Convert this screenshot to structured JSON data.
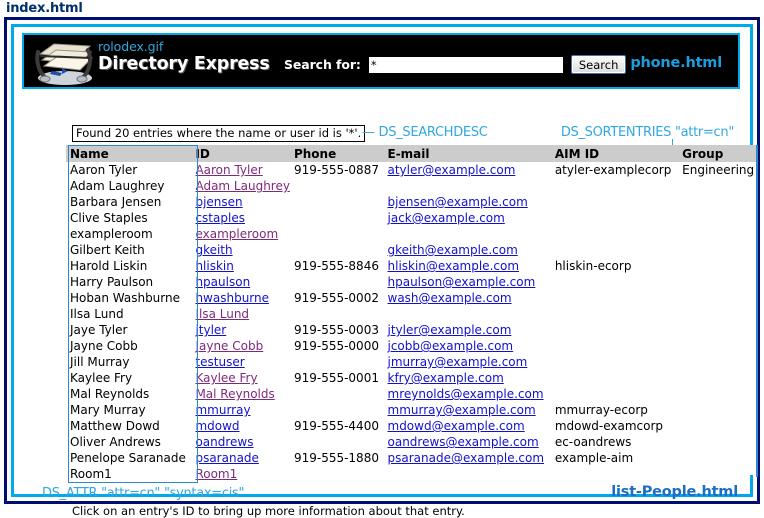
{
  "page": {
    "title": "index.html"
  },
  "header": {
    "logo_icon": "rolodex-icon",
    "image_filename": "rolodex.gif",
    "app_title": "Directory Express",
    "search_label": "Search for:",
    "search_value": "*",
    "search_placeholder": "",
    "search_button": "Search",
    "corner_link": "phone.html",
    "accent_cyan": "#00a8ec",
    "frame_navy": "#000e6e"
  },
  "annotations": {
    "search_description": "Found 20 entries where the name or user id is '*'.",
    "searchdesc_tag": "— DS_SEARCHDESC",
    "sortentries_tag": "DS_SORTENTRIES",
    "sortentries_arg": "\"attr=cn\"",
    "attr_tag": "DS_ATTR \"attr=cn\" \"syntax=cis\"",
    "footer_link": "list-People.html"
  },
  "table": {
    "columns": [
      "Name",
      "ID",
      "Phone",
      "E-mail",
      "AIM ID",
      "Group"
    ],
    "rows": [
      {
        "name": "Aaron Tyler",
        "id": "Aaron Tyler",
        "id_state": "visited",
        "phone": "919-555-0887",
        "email": "atyler@example.com",
        "email_state": "blue",
        "aim": "atyler-examplecorp",
        "group": "Engineering"
      },
      {
        "name": "Adam Laughrey",
        "id": "Adam Laughrey",
        "id_state": "visited",
        "phone": "",
        "email": "",
        "email_state": "blue",
        "aim": "",
        "group": ""
      },
      {
        "name": "Barbara Jensen",
        "id": "bjensen",
        "id_state": "blue",
        "phone": "",
        "email": "bjensen@example.com",
        "email_state": "blue",
        "aim": "",
        "group": ""
      },
      {
        "name": "Clive Staples",
        "id": "cstaples",
        "id_state": "blue",
        "phone": "",
        "email": "jack@example.com",
        "email_state": "blue",
        "aim": "",
        "group": ""
      },
      {
        "name": "exampleroom",
        "id": "exampleroom",
        "id_state": "visited",
        "phone": "",
        "email": "",
        "email_state": "blue",
        "aim": "",
        "group": ""
      },
      {
        "name": "Gilbert Keith",
        "id": "gkeith",
        "id_state": "blue",
        "phone": "",
        "email": "gkeith@example.com",
        "email_state": "blue",
        "aim": "",
        "group": ""
      },
      {
        "name": "Harold Liskin",
        "id": "hliskin",
        "id_state": "blue",
        "phone": "919-555-8846",
        "email": "hliskin@example.com",
        "email_state": "blue",
        "aim": "hliskin-ecorp",
        "group": ""
      },
      {
        "name": "Harry Paulson",
        "id": "hpaulson",
        "id_state": "blue",
        "phone": "",
        "email": "hpaulson@example.com",
        "email_state": "blue",
        "aim": "",
        "group": ""
      },
      {
        "name": "Hoban Washburne",
        "id": "hwashburne",
        "id_state": "blue",
        "phone": "919-555-0002",
        "email": "wash@example.com",
        "email_state": "blue",
        "aim": "",
        "group": ""
      },
      {
        "name": "Ilsa Lund",
        "id": "Ilsa Lund",
        "id_state": "visited",
        "phone": "",
        "email": "",
        "email_state": "blue",
        "aim": "",
        "group": ""
      },
      {
        "name": "Jaye Tyler",
        "id": "jtyler",
        "id_state": "blue",
        "phone": "919-555-0003",
        "email": "jtyler@example.com",
        "email_state": "blue",
        "aim": "",
        "group": ""
      },
      {
        "name": "Jayne Cobb",
        "id": "Jayne Cobb",
        "id_state": "visited",
        "phone": "919-555-0000",
        "email": "jcobb@example.com",
        "email_state": "blue",
        "aim": "",
        "group": ""
      },
      {
        "name": "Jill Murray",
        "id": "testuser",
        "id_state": "blue",
        "phone": "",
        "email": "jmurray@example.com",
        "email_state": "blue",
        "aim": "",
        "group": ""
      },
      {
        "name": "Kaylee Fry",
        "id": "Kaylee Fry",
        "id_state": "visited",
        "phone": "919-555-0001",
        "email": "kfry@example.com",
        "email_state": "blue",
        "aim": "",
        "group": ""
      },
      {
        "name": "Mal Reynolds",
        "id": "Mal Reynolds",
        "id_state": "visited",
        "phone": "",
        "email": "mreynolds@example.com",
        "email_state": "blue",
        "aim": "",
        "group": ""
      },
      {
        "name": "Mary Murray",
        "id": "mmurray",
        "id_state": "blue",
        "phone": "",
        "email": "mmurray@example.com",
        "email_state": "blue",
        "aim": "mmurray-ecorp",
        "group": ""
      },
      {
        "name": "Matthew Dowd",
        "id": "mdowd",
        "id_state": "blue",
        "phone": "919-555-4400",
        "email": "mdowd@example.com",
        "email_state": "blue",
        "aim": "mdowd-examcorp",
        "group": ""
      },
      {
        "name": "Oliver Andrews",
        "id": "oandrews",
        "id_state": "blue",
        "phone": "",
        "email": "oandrews@example.com",
        "email_state": "blue",
        "aim": "ec-oandrews",
        "group": ""
      },
      {
        "name": "Penelope Saranade",
        "id": "psaranade",
        "id_state": "blue",
        "phone": "919-555-1880",
        "email": "psaranade@example.com",
        "email_state": "blue",
        "aim": "example-aim",
        "group": ""
      },
      {
        "name": "Room1",
        "id": "Room1",
        "id_state": "visited",
        "phone": "",
        "email": "",
        "email_state": "blue",
        "aim": "",
        "group": ""
      }
    ]
  },
  "footer": {
    "hint": "Click on an entry's ID to bring up more information about that entry."
  }
}
